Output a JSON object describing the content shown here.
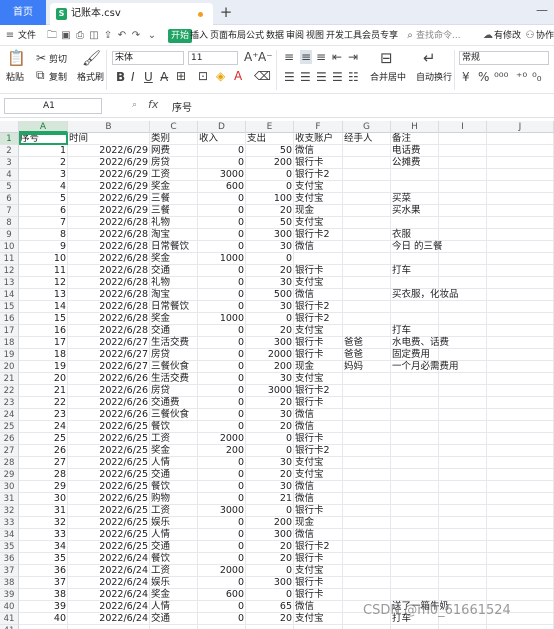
{
  "titlebar": {
    "home_tab": "首页",
    "file_tab": "记账本.csv",
    "new_tab": "+",
    "minimize": "—"
  },
  "menubar": {
    "file_menu": "文件",
    "items": [
      "开始",
      "插入",
      "页面布局",
      "公式",
      "数据",
      "审阅",
      "视图",
      "开发工具",
      "会员专享"
    ],
    "search": "查找命令...",
    "right": [
      "有修改",
      "协作"
    ]
  },
  "ribbon": {
    "paste": "粘贴",
    "cut": "剪切",
    "copy": "复制",
    "format_painter": "格式刷",
    "font_name": "宋体",
    "font_size": "11",
    "merge": "合并居中",
    "wrap": "自动换行",
    "number_format": "常规"
  },
  "formulabar": {
    "cell_ref": "A1",
    "fx": "fx",
    "value": "序号"
  },
  "columns": [
    "A",
    "B",
    "C",
    "D",
    "E",
    "F",
    "G",
    "H",
    "I",
    "J"
  ],
  "header_row": [
    "序号",
    "时间",
    "类别",
    "收入",
    "支出",
    "收支账户",
    "经手人",
    "备注",
    "",
    ""
  ],
  "rows": [
    [
      "1",
      "2022/6/29",
      "网费",
      "0",
      "50",
      "微信",
      "",
      "电话费"
    ],
    [
      "2",
      "2022/6/29",
      "房贷",
      "0",
      "200",
      "银行卡",
      "",
      "公摊费"
    ],
    [
      "3",
      "2022/6/29",
      "工资",
      "3000",
      "0",
      "银行卡2",
      "",
      ""
    ],
    [
      "4",
      "2022/6/29",
      "奖金",
      "600",
      "0",
      "支付宝",
      "",
      ""
    ],
    [
      "5",
      "2022/6/29",
      "三餐",
      "0",
      "100",
      "支付宝",
      "",
      "买菜"
    ],
    [
      "6",
      "2022/6/29",
      "三餐",
      "0",
      "20",
      "现金",
      "",
      "买水果"
    ],
    [
      "7",
      "2022/6/28",
      "礼物",
      "0",
      "50",
      "支付宝",
      "",
      ""
    ],
    [
      "8",
      "2022/6/28",
      "淘宝",
      "0",
      "300",
      "银行卡2",
      "",
      "衣服"
    ],
    [
      "9",
      "2022/6/28",
      "日常餐饮",
      "0",
      "30",
      "微信",
      "",
      "今日 的三餐"
    ],
    [
      "10",
      "2022/6/28",
      "奖金",
      "1000",
      "0",
      "",
      "",
      ""
    ],
    [
      "11",
      "2022/6/28",
      "交通",
      "0",
      "20",
      "银行卡",
      "",
      "打车"
    ],
    [
      "12",
      "2022/6/28",
      "礼物",
      "0",
      "30",
      "支付宝",
      "",
      ""
    ],
    [
      "13",
      "2022/6/28",
      "淘宝",
      "0",
      "500",
      "微信",
      "",
      "买衣服，化妆品"
    ],
    [
      "14",
      "2022/6/28",
      "日常餐饮",
      "0",
      "30",
      "银行卡2",
      "",
      ""
    ],
    [
      "15",
      "2022/6/28",
      "奖金",
      "1000",
      "0",
      "银行卡2",
      "",
      ""
    ],
    [
      "16",
      "2022/6/28",
      "交通",
      "0",
      "20",
      "支付宝",
      "",
      "打车"
    ],
    [
      "17",
      "2022/6/27",
      "生活交费",
      "0",
      "300",
      "银行卡",
      "爸爸",
      "水电费、话费"
    ],
    [
      "18",
      "2022/6/27",
      "房贷",
      "0",
      "2000",
      "银行卡",
      "爸爸",
      "固定费用"
    ],
    [
      "19",
      "2022/6/27",
      "三餐伙食",
      "0",
      "200",
      "现金",
      "妈妈",
      "一个月必需费用"
    ],
    [
      "20",
      "2022/6/26",
      "生活交费",
      "0",
      "30",
      "支付宝",
      "",
      ""
    ],
    [
      "21",
      "2022/6/26",
      "房贷",
      "0",
      "3000",
      "银行卡2",
      "",
      ""
    ],
    [
      "22",
      "2022/6/26",
      "交通费",
      "0",
      "20",
      "银行卡",
      "",
      ""
    ],
    [
      "23",
      "2022/6/26",
      "三餐伙食",
      "0",
      "30",
      "微信",
      "",
      ""
    ],
    [
      "24",
      "2022/6/25",
      "餐饮",
      "0",
      "20",
      "微信",
      "",
      ""
    ],
    [
      "25",
      "2022/6/25",
      "工资",
      "2000",
      "0",
      "银行卡",
      "",
      ""
    ],
    [
      "26",
      "2022/6/25",
      "奖金",
      "200",
      "0",
      "银行卡2",
      "",
      ""
    ],
    [
      "27",
      "2022/6/25",
      "人情",
      "0",
      "30",
      "支付宝",
      "",
      ""
    ],
    [
      "28",
      "2022/6/25",
      "交通",
      "0",
      "20",
      "支付宝",
      "",
      ""
    ],
    [
      "29",
      "2022/6/25",
      "餐饮",
      "0",
      "30",
      "微信",
      "",
      ""
    ],
    [
      "30",
      "2022/6/25",
      "购物",
      "0",
      "21",
      "微信",
      "",
      ""
    ],
    [
      "31",
      "2022/6/25",
      "工资",
      "3000",
      "0",
      "银行卡",
      "",
      ""
    ],
    [
      "32",
      "2022/6/25",
      "娱乐",
      "0",
      "200",
      "现金",
      "",
      ""
    ],
    [
      "33",
      "2022/6/25",
      "人情",
      "0",
      "300",
      "微信",
      "",
      ""
    ],
    [
      "34",
      "2022/6/25",
      "交通",
      "0",
      "20",
      "银行卡2",
      "",
      ""
    ],
    [
      "35",
      "2022/6/24",
      "餐饮",
      "0",
      "20",
      "银行卡",
      "",
      ""
    ],
    [
      "36",
      "2022/6/24",
      "工资",
      "2000",
      "0",
      "支付宝",
      "",
      ""
    ],
    [
      "37",
      "2022/6/24",
      "娱乐",
      "0",
      "300",
      "银行卡",
      "",
      ""
    ],
    [
      "38",
      "2022/6/24",
      "奖金",
      "600",
      "0",
      "银行卡",
      "",
      ""
    ],
    [
      "39",
      "2022/6/24",
      "人情",
      "0",
      "65",
      "微信",
      "",
      "送了一箱牛奶"
    ],
    [
      "40",
      "2022/6/24",
      "交通",
      "0",
      "20",
      "支付宝",
      "",
      "打车"
    ]
  ],
  "extra_row_number": "41",
  "watermark": "CSDN @m0_61661524"
}
